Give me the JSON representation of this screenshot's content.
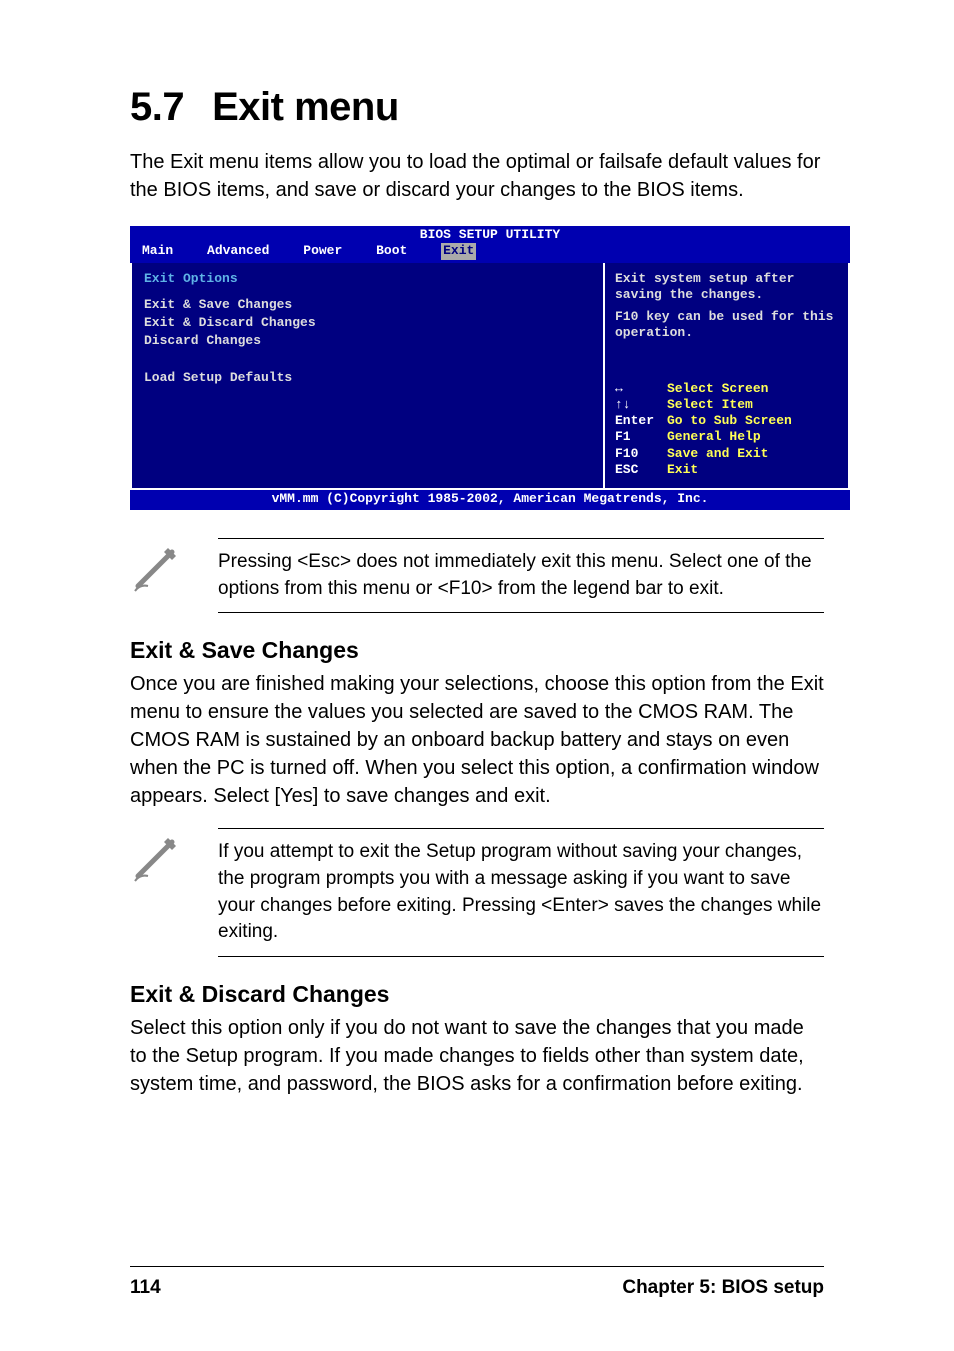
{
  "page": {
    "section_num": "5.7",
    "section_name": "Exit menu",
    "intro": "The Exit menu items allow you to load the optimal or failsafe default values for the BIOS items, and save or discard your changes to the BIOS items."
  },
  "bios": {
    "title": "BIOS SETUP UTILITY",
    "tabs": [
      "Main",
      "Advanced",
      "Power",
      "Boot",
      "Exit"
    ],
    "active_tab": "Exit",
    "left": {
      "header": "Exit Options",
      "items": [
        "Exit & Save Changes",
        "Exit & Discard Changes",
        "Discard Changes",
        "",
        "Load Setup Defaults"
      ]
    },
    "right": {
      "help1": "Exit system setup after saving the changes.",
      "help2": "F10 key can be used for this operation.",
      "keys": [
        {
          "key": "↔",
          "desc": "Select Screen"
        },
        {
          "key": "↑↓",
          "desc": "Select Item"
        },
        {
          "key": "Enter",
          "desc": "Go to Sub Screen"
        },
        {
          "key": "F1",
          "desc": "General Help"
        },
        {
          "key": "F10",
          "desc": "Save and Exit"
        },
        {
          "key": "ESC",
          "desc": "Exit"
        }
      ]
    },
    "footer": "vMM.mm (C)Copyright 1985-2002, American Megatrends, Inc."
  },
  "note1": "Pressing <Esc> does not immediately exit this menu. Select one of the options from this menu or <F10> from the legend bar to exit.",
  "sections": {
    "save": {
      "heading": "Exit & Save Changes",
      "body": "Once you are finished making your selections, choose this option from the Exit menu to ensure the values you selected are saved to the CMOS RAM. The CMOS RAM is sustained by an onboard backup battery and stays on even when the PC is turned off. When you select this option, a confirmation window appears. Select [Yes] to save changes and exit."
    },
    "discard": {
      "heading": "Exit & Discard Changes",
      "body": "Select this option only if you do not want to save the changes that you made to the Setup program. If you made changes to fields other than system date, system time, and password, the BIOS asks for a confirmation before exiting."
    }
  },
  "note2": "If you attempt to exit the Setup program without saving your changes, the program prompts you with a message asking if you want to save your changes before exiting. Pressing <Enter> saves the  changes while exiting.",
  "footer": {
    "page_number": "114",
    "chapter": "Chapter 5: BIOS setup"
  }
}
